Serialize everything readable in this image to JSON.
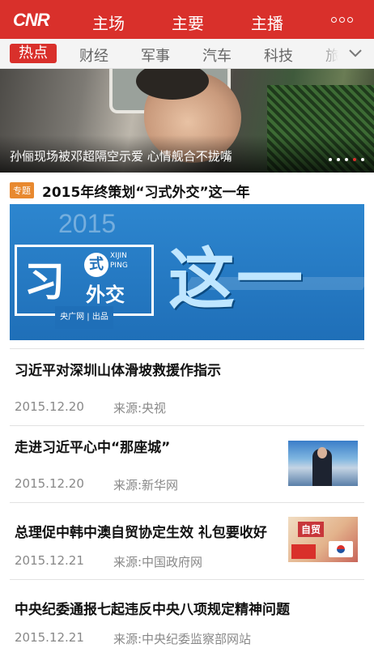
{
  "header": {
    "logo": "CNR",
    "tabs": [
      {
        "label": "主场"
      },
      {
        "label": "主要",
        "active": true
      },
      {
        "label": "主播"
      }
    ],
    "more_icon": "more-horizontal-icon"
  },
  "categories": {
    "items": [
      "热点",
      "财经",
      "军事",
      "汽车",
      "科技",
      "旅"
    ],
    "active_index": 0,
    "expand_icon": "chevron-down-icon"
  },
  "carousel": {
    "caption": "孙俪现场被邓超隔空示爱 心情舰合不拢嘴",
    "page_count": 5,
    "current_page": 4
  },
  "feature": {
    "badge": "专题",
    "title": "2015年终策划“习式外交”这一年",
    "banner": {
      "year": "2015",
      "char_xi": "习",
      "char_seal": "式",
      "pinyin_1": "XIJIN",
      "pinyin_2": "PING",
      "subtitle": "外交",
      "producer": "央广网 | 出品",
      "big_text": "这一年"
    }
  },
  "news": [
    {
      "title": "习近平对深圳山体滑坡救援作指示",
      "date": "2015.12.20",
      "source": "来源:央视",
      "thumb": null
    },
    {
      "title": "走进习近平心中“那座城”",
      "date": "2015.12.20",
      "source": "来源:新华网",
      "thumb": "portrait-photo"
    },
    {
      "title": "总理促中韩中澳自贸协定生效 礼包要收好",
      "date": "2015.12.21",
      "source": "来源:中国政府网",
      "thumb": "trade-agreement-photo",
      "thumb_label": "自贸"
    },
    {
      "title": "中央纪委通报七起违反中央八项规定精神问题",
      "date": "2015.12.21",
      "source": "来源:中央纪委监察部网站",
      "thumb": null
    }
  ],
  "colors": {
    "brand_red": "#d9302b",
    "badge_orange": "#e8892f",
    "banner_blue": "#1f6fb8"
  }
}
